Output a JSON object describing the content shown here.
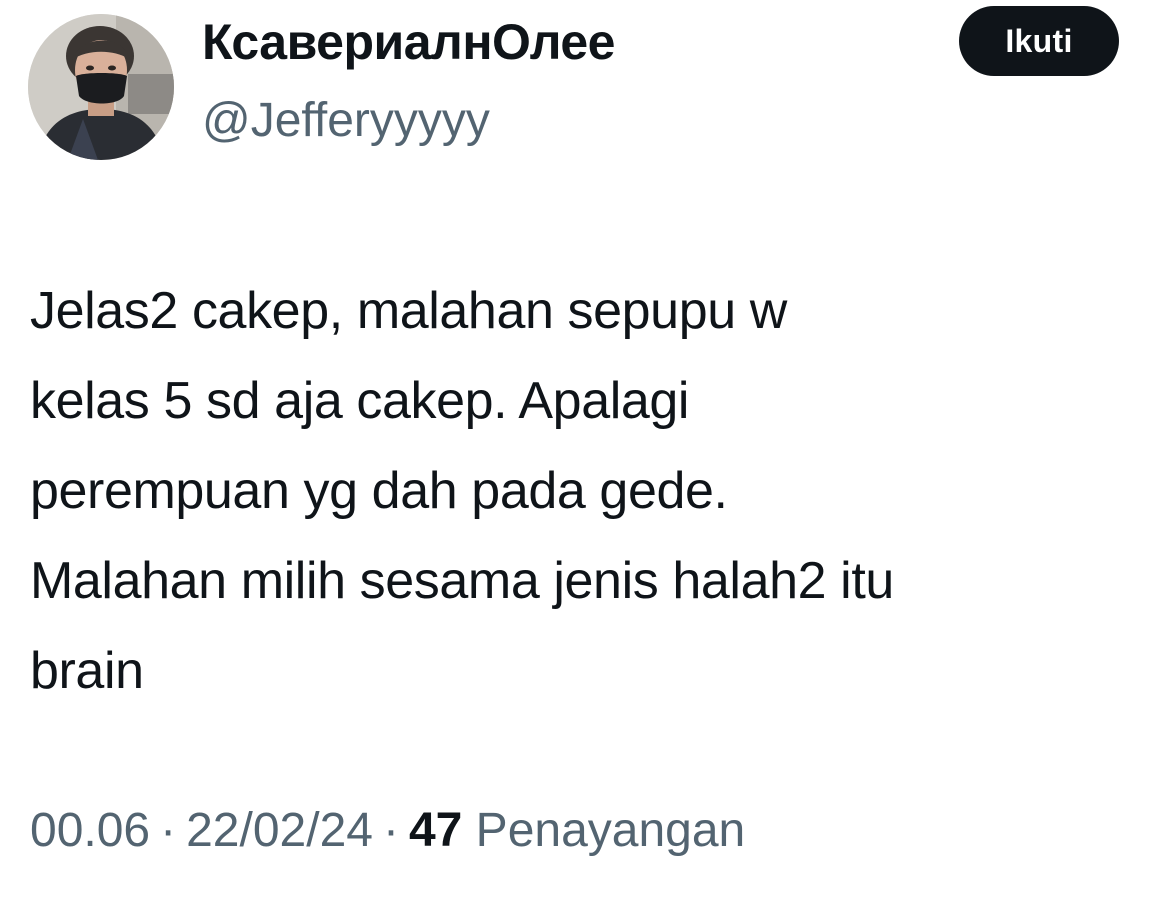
{
  "author": {
    "display_name": "КсавериалнОлее",
    "handle": "@Jefferyyyyy"
  },
  "follow_button": {
    "label": "Ikuti"
  },
  "tweet": {
    "text": "Jelas2 cakep, malahan sepupu w\nkelas 5 sd aja cakep. Apalagi\nperempuan yg dah pada gede.\nMalahan milih sesama jenis halah2 itu\nbrain"
  },
  "meta": {
    "time": "00.06",
    "separator": "·",
    "date": "22/02/24",
    "views_count": "47",
    "views_label": "Penayangan"
  },
  "colors": {
    "text_primary": "#0f1419",
    "text_secondary": "#536471",
    "button_bg": "#0f1419",
    "button_text": "#ffffff",
    "background": "#ffffff"
  }
}
